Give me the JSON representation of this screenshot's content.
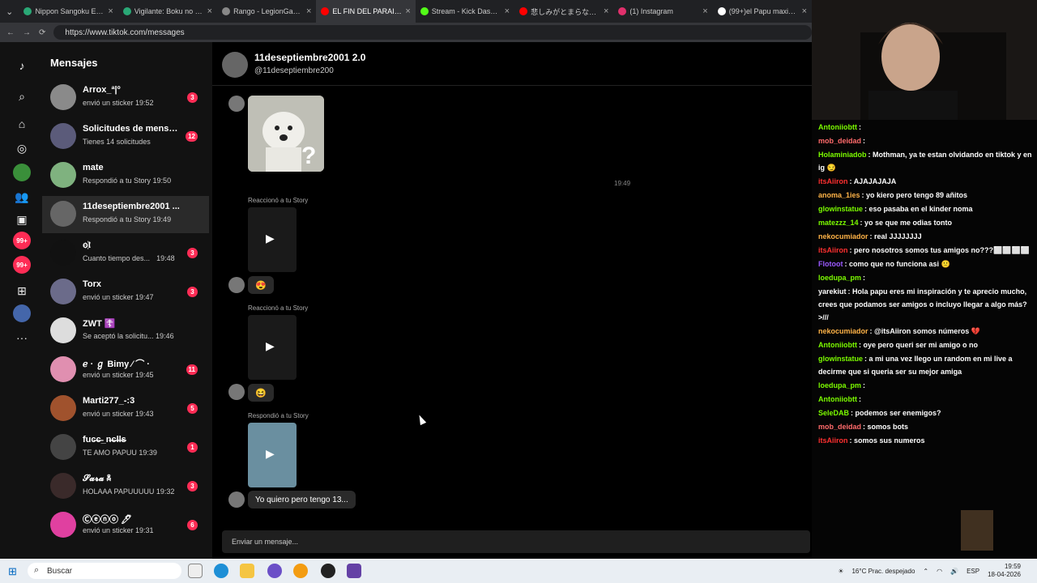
{
  "browser": {
    "tabs": [
      {
        "label": "Nippon Sangoku Episo",
        "active": false,
        "icon": "globe-icon",
        "color": "#2aa876"
      },
      {
        "label": "Vigilante: Boku no Her",
        "active": false,
        "icon": "globe-icon",
        "color": "#2aa876"
      },
      {
        "label": "Rango - LegionGamesC",
        "active": false,
        "icon": "globe-icon",
        "color": "#888888"
      },
      {
        "label": "EL FIN DEL PARAISO - m",
        "active": true,
        "icon": "youtube-icon",
        "color": "#ff0000"
      },
      {
        "label": "Stream - Kick Dashboa",
        "active": false,
        "icon": "kick-icon",
        "color": "#53fc18"
      },
      {
        "label": "悲しみがとまらない I CAN",
        "active": false,
        "icon": "youtube-icon",
        "color": "#ff0000"
      },
      {
        "label": "(1) Instagram",
        "active": false,
        "icon": "instagram-icon",
        "color": "#e1306c"
      },
      {
        "label": "(99+)el Papu maximo (@",
        "active": false,
        "icon": "tiktok-icon",
        "color": "#ffffff"
      }
    ],
    "url": "https://www.tiktok.com/messages"
  },
  "sidebar": {
    "badge_messages": "99+",
    "badge_activity": "99+"
  },
  "conversations": {
    "title": "Mensajes",
    "items": [
      {
        "name": "Arrox_ª|º",
        "preview": "envió un sticker 19:52",
        "badge": "3",
        "color": "#8a8a8a"
      },
      {
        "name": "Solicitudes de mensaj...",
        "preview": "Tienes 14 solicitudes",
        "badge": "12",
        "color": "#5b5b7a"
      },
      {
        "name": "mate",
        "preview": "Respondió a tu Story 19:50",
        "badge": "",
        "color": "#7fb27f"
      },
      {
        "name": "11deseptiembre2001 ...",
        "preview": "Respondió a tu Story 19:49",
        "badge": "",
        "color": "#666666"
      },
      {
        "name": "o҉I",
        "preview": "Cuanto tiempo des...",
        "time": "19:48",
        "badge": "3",
        "color": "#111111"
      },
      {
        "name": "Torx",
        "preview": "envió un sticker 19:47",
        "badge": "3",
        "color": "#6b6b8a"
      },
      {
        "name": "ZWT ☦️",
        "preview": "Se aceptó la solicitu... 19:46",
        "badge": "",
        "color": "#dddddd"
      },
      {
        "name": "ℯ · ℊ Bimy ⁄ ⌒ ·",
        "preview": "envió un sticker 19:45",
        "badge": "11",
        "color": "#e08fb0"
      },
      {
        "name": "Marti277_-:3",
        "preview": "envió un sticker 19:43",
        "badge": "5",
        "color": "#a0522d"
      },
      {
        "name": "fuc̶c̶_n̶c̶l̶l̶s̶",
        "preview": "TE AMO PAPUU 19:39",
        "badge": "1",
        "color": "#444444"
      },
      {
        "name": "𝓢𝓪𝓻𝓪 ☠",
        "preview": "HOLAAA PAPUUUUU 19:32",
        "badge": "3",
        "color": "#3a2a2a"
      },
      {
        "name": "Ⓒⓔⓝⓞ 🖊",
        "preview": "envió un sticker 19:31",
        "badge": "6",
        "color": "#e040a0"
      }
    ]
  },
  "chat": {
    "name": "11deseptiembre2001 2.0",
    "handle": "@11deseptiembre200",
    "time": "19:49",
    "react1": "Reaccionó a tu Story",
    "emoji1": "😍",
    "react2": "Reaccionó a tu Story",
    "emoji2": "😆",
    "reply": "Respondió a tu Story",
    "last_message": "Yo quiero pero tengo 13...",
    "input_placeholder": "Enviar un mensaje..."
  },
  "stream_chat": [
    {
      "user": "Antoniiobtt",
      "text": "",
      "color": "#7cfc00"
    },
    {
      "user": "mob_deidad",
      "text": "",
      "color": "#ff6b6b"
    },
    {
      "user": "Holaminiadob",
      "text": "Mothman, ya te estan olvidando en tiktok y en ig 😏",
      "color": "#7cfc00"
    },
    {
      "user": "itsAiiron",
      "text": "AJAJAJAJA",
      "color": "#ff3030"
    },
    {
      "user": "anoma_1ies",
      "text": "yo kiero pero tengo 89 añitos",
      "color": "#ffb347"
    },
    {
      "user": "glowinstatue",
      "text": "eso pasaba en el kinder noma",
      "color": "#7cfc00"
    },
    {
      "user": "matezzz_14",
      "text": "yo se que me odias tonto",
      "color": "#7cfc00"
    },
    {
      "user": "nekocumiador",
      "text": "real JJJJJJJJ",
      "color": "#ffb347"
    },
    {
      "user": "itsAiiron",
      "text": "pero nosotros somos tus amigos no???⬜⬜⬜⬜",
      "color": "#ff3030"
    },
    {
      "user": "Flotoot",
      "text": "como que no funciona asi 🙁",
      "color": "#9b59ff"
    },
    {
      "user": "loedupa_pm",
      "text": "",
      "color": "#7cfc00"
    },
    {
      "user": "yarekiut",
      "text": "Hola papu eres mi inspiración y te aprecio mucho, crees que podamos ser amigos o incluyo llegar a algo más? >///",
      "color": "#ffffff"
    },
    {
      "user": "nekocumiador",
      "text": "@itsAiiron somos números 💔",
      "color": "#ffb347"
    },
    {
      "user": "Antoniiobtt",
      "text": "oye pero queri ser mi amigo o no",
      "color": "#7cfc00"
    },
    {
      "user": "glowinstatue",
      "text": "a mi una vez llego un random en mi live a decirme que si queria ser su mejor amiga",
      "color": "#7cfc00"
    },
    {
      "user": "loedupa_pm",
      "text": "",
      "color": "#7cfc00"
    },
    {
      "user": "Antoniiobtt",
      "text": "",
      "color": "#7cfc00"
    },
    {
      "user": "SeleDAB",
      "text": "podemos ser enemigos?",
      "color": "#7cfc00"
    },
    {
      "user": "mob_deidad",
      "text": "somos bots",
      "color": "#ff6b6b"
    },
    {
      "user": "itsAiiron",
      "text": "somos sus numeros",
      "color": "#ff3030"
    }
  ],
  "taskbar": {
    "search_label": "Buscar",
    "weather": "16°C  Prac. despejado",
    "lang": "ESP",
    "time": "19:59",
    "date": "18-04-2026"
  }
}
